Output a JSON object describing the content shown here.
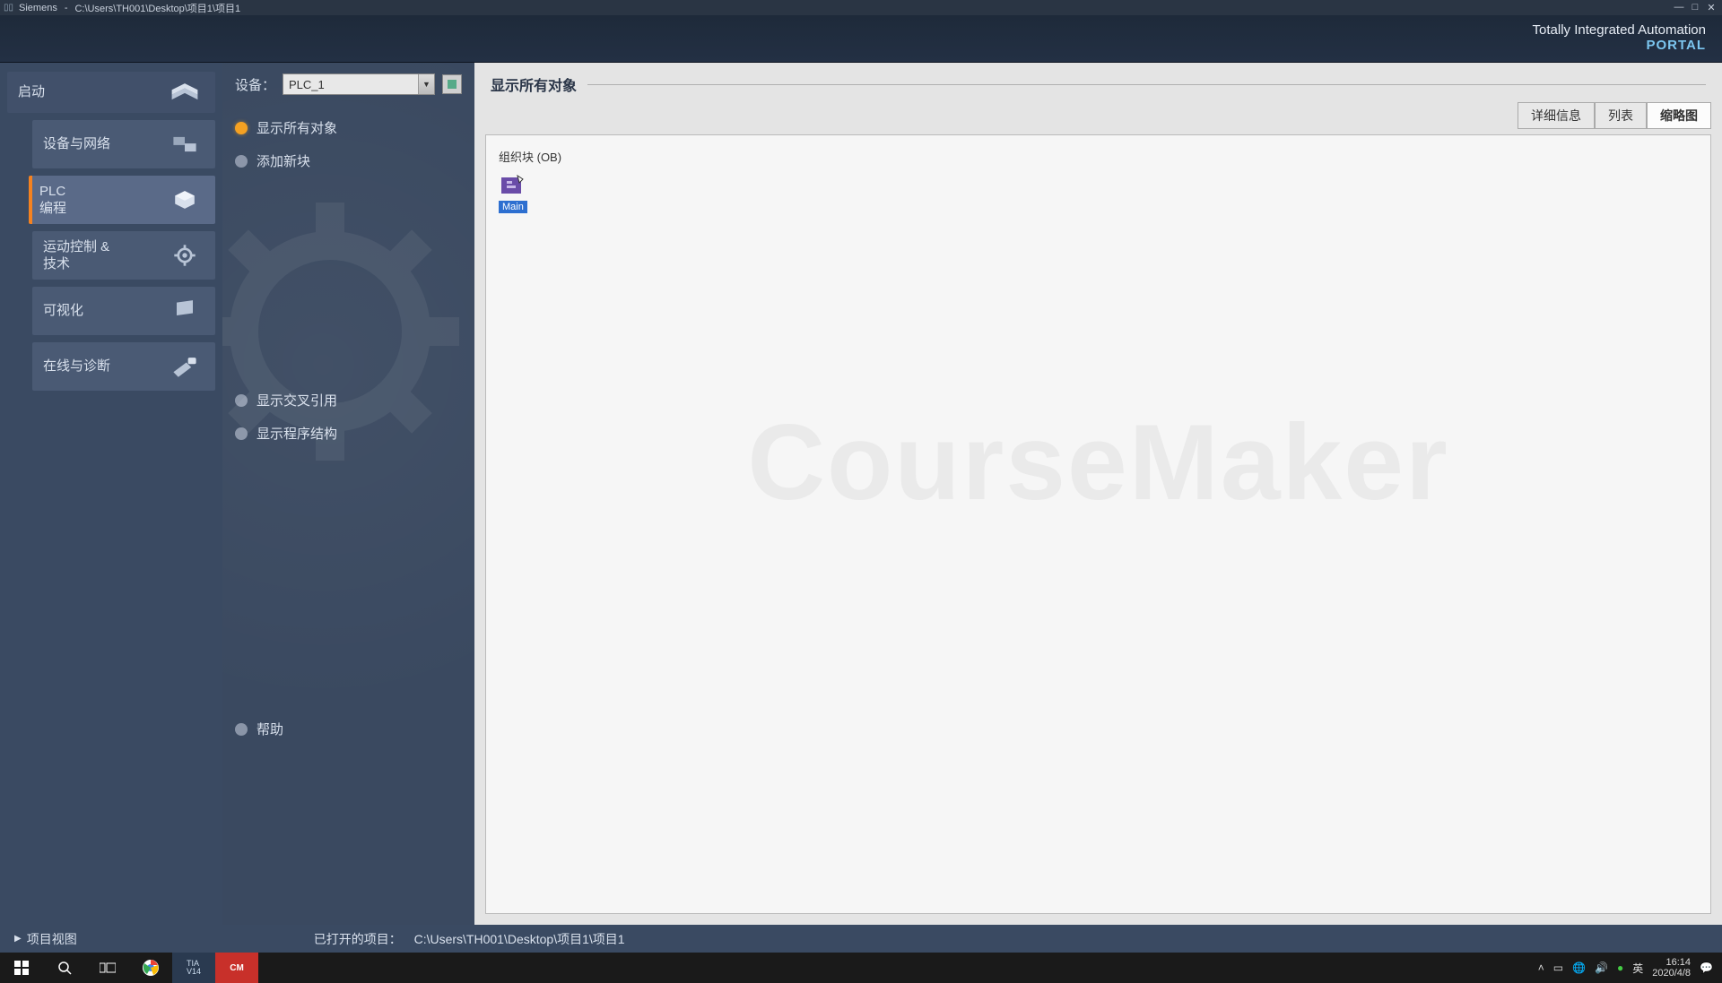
{
  "titlebar": {
    "app": "Siemens",
    "sep": "-",
    "path": "C:\\Users\\TH001\\Desktop\\项目1\\项目1"
  },
  "branding": {
    "line1": "Totally Integrated Automation",
    "line2": "PORTAL"
  },
  "leftnav": {
    "start": "启动",
    "devices": "设备与网络",
    "plc": "PLC\n编程",
    "motion": "运动控制 &\n技术",
    "visual": "可视化",
    "online": "在线与诊断"
  },
  "subpanel": {
    "device_label": "设备：",
    "device_selected": "PLC_1",
    "items": {
      "show_all": "显示所有对象",
      "add_block": "添加新块",
      "cross_ref": "显示交叉引用",
      "prog_struct": "显示程序结构",
      "help": "帮助"
    }
  },
  "content": {
    "header": "显示所有对象",
    "tabs": {
      "detail": "详细信息",
      "list": "列表",
      "thumb": "缩略图"
    },
    "group_label": "组织块 (OB)",
    "block_name": "Main",
    "watermark": "CourseMaker"
  },
  "statusbar": {
    "project_view": "项目视图",
    "opened_label": "已打开的项目：",
    "opened_path": "C:\\Users\\TH001\\Desktop\\项目1\\项目1"
  },
  "taskbar": {
    "ime": "英",
    "time": "16:14",
    "date": "2020/4/8"
  }
}
